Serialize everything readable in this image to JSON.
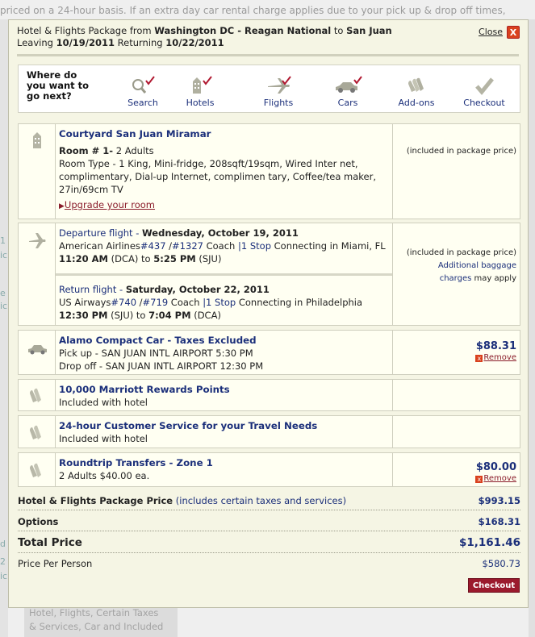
{
  "background": {
    "top_text": "priced on a 24-hour basis. If an extra day car rental charge applies due to your pick up & drop off times,",
    "bottom_lines": [
      "Hotel, Flights, Certain Taxes",
      "& Services, Car and Included"
    ],
    "left_fragments": [
      "1",
      "ic",
      "e",
      "ic",
      "d",
      "2",
      "ic"
    ]
  },
  "header": {
    "prefix": "Hotel & Flights Package from ",
    "origin": "Washington DC - Reagan National",
    "to_word": " to ",
    "destination": "San Juan",
    "leaving_word": "Leaving ",
    "leave_date": "10/19/2011",
    "returning_word": " Returning ",
    "return_date": "10/22/2011",
    "close_label": "Close",
    "close_x": "X"
  },
  "steps": {
    "question": "Where do you want to go next?",
    "items": [
      {
        "label": "Search",
        "icon": "magnifier-icon",
        "checked": true
      },
      {
        "label": "Hotels",
        "icon": "hotel-icon",
        "checked": true
      },
      {
        "label": "Flights",
        "icon": "airplane-icon",
        "checked": true
      },
      {
        "label": "Cars",
        "icon": "car-icon",
        "checked": true
      },
      {
        "label": "Add-ons",
        "icon": "addons-icon",
        "checked": false
      },
      {
        "label": "Checkout",
        "icon": "checkmark-icon",
        "checked": false
      }
    ]
  },
  "hotel": {
    "name": "Courtyard San Juan Miramar",
    "room_label": "Room # 1-",
    "room_guests": " 2 Adults",
    "room_type": "Room Type - 1 King, Mini-fridge, 208sqft/19sqm, Wired Inter net, complimentary, Dial-up Internet, complimen tary, Coffee/tea maker, 27in/69cm TV",
    "upgrade": "Upgrade your room",
    "price_note": "(included in package price)"
  },
  "flights": {
    "departure": {
      "label": "Departure flight - ",
      "date": "Wednesday, October 19, 2011",
      "airline": "American Airlines",
      "flight1": "#437",
      "slash": " /",
      "flight2": "#1327",
      "cabin": " Coach ",
      "stops": "|1 Stop",
      "connect": " Connecting in Miami, FL",
      "dep_time": "11:20 AM",
      "dep_code": " (DCA) to ",
      "arr_time": "5:25 PM",
      "arr_code": " (SJU)"
    },
    "return": {
      "label": "Return flight - ",
      "date": "Saturday, October 22, 2011",
      "airline": "US Airways",
      "flight1": "#740",
      "slash": " /",
      "flight2": "#719",
      "cabin": " Coach ",
      "stops": "|1 Stop",
      "connect": " Connecting in Philadelphia",
      "dep_time": "12:30 PM",
      "dep_code": " (SJU) to ",
      "arr_time": "7:04 PM",
      "arr_code": " (DCA)"
    },
    "price_note": "(included in package price)",
    "baggage_link": "Additional baggage",
    "baggage_link2": "charges",
    "baggage_rest": " may apply"
  },
  "car": {
    "name": "Alamo Compact Car - Taxes Excluded",
    "pickup": "Pick up - SAN JUAN INTL AIRPORT 5:30 PM",
    "dropoff": "Drop off - SAN JUAN INTL AIRPORT 12:30 PM",
    "price": "$88.31",
    "remove": "Remove"
  },
  "addons": [
    {
      "name": "10,000 Marriott Rewards Points",
      "desc": "Included with hotel"
    },
    {
      "name": "24-hour Customer Service for your Travel Needs",
      "desc": "Included with hotel"
    },
    {
      "name": "Roundtrip Transfers - Zone 1",
      "desc": "2 Adults $40.00 ea.",
      "price": "$80.00",
      "remove": "Remove"
    }
  ],
  "totals": {
    "package_label": "Hotel & Flights Package Price",
    "package_note": " (includes certain taxes and services)",
    "package_price": "$993.15",
    "options_label": "Options",
    "options_price": "$168.31",
    "total_label": "Total Price",
    "total_price": "$1,161.46",
    "per_person_label": "Price Per Person",
    "per_person_price": "$580.73"
  },
  "checkout_button": "Checkout",
  "colors": {
    "accent": "#1b2f7a",
    "button": "#9b1a2d",
    "remove": "#d9411e",
    "panel": "#f5f5e4"
  }
}
